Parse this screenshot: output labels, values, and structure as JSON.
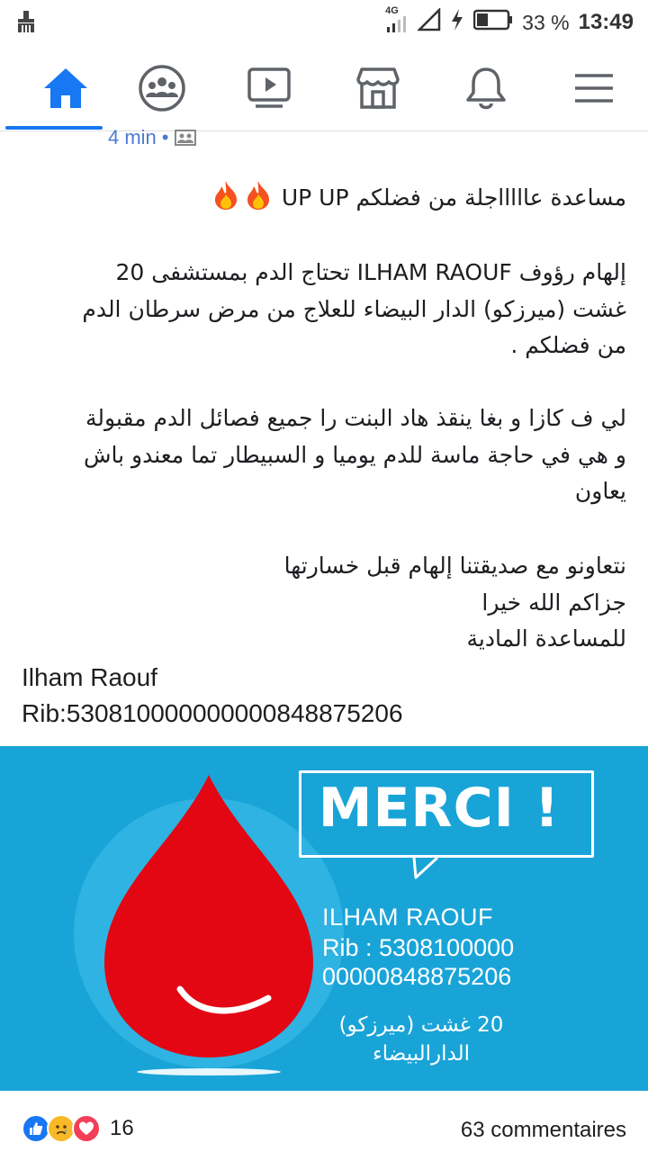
{
  "status_bar": {
    "network": "4G",
    "battery_percent": "33 %",
    "time": "13:49"
  },
  "nav": {
    "items": [
      "home",
      "groups",
      "watch",
      "marketplace",
      "notifications",
      "menu"
    ],
    "active": "home",
    "accent": "#1877f2"
  },
  "post": {
    "time": "4 min",
    "paragraph1": "مساعدة عاااااجلة من فضلكم UP UP",
    "paragraph2_lines": [
      "إلهام رؤوف ILHAM RAOUF تحتاج الدم بمستشفى 20",
      "غشت (ميرزكو) الدار البيضاء للعلاج من مرض سرطان الدم",
      "من فضلكم ."
    ],
    "paragraph3_lines": [
      "لي ف كازا و بغا ينقذ هاد البنت را جميع فصائل الدم مقبولة",
      "و هي في حاجة ماسة للدم يوميا و السبيطار تما معندو باش",
      "يعاون"
    ],
    "paragraph4_lines": [
      "نتعاونو مع صديقتنا إلهام قبل خسارتها",
      "جزاكم الله خيرا",
      "للمساعدة المادية"
    ],
    "name_line": "Ilham Raouf",
    "rib_line": "Rib:530810000000000848875206"
  },
  "image": {
    "merci": "MERCI !",
    "name": "ILHAM  RAOUF",
    "rib_line1": "Rib : 5308100000",
    "rib_line2": "00000848875206",
    "hospital_line1": "20 غشت (ميرزكو)",
    "hospital_line2": "الدارالبيضاء",
    "bg_color": "#19a4d8",
    "drop_color": "#e30613"
  },
  "footer": {
    "reaction_count": "16",
    "comments": "63 commentaires"
  }
}
